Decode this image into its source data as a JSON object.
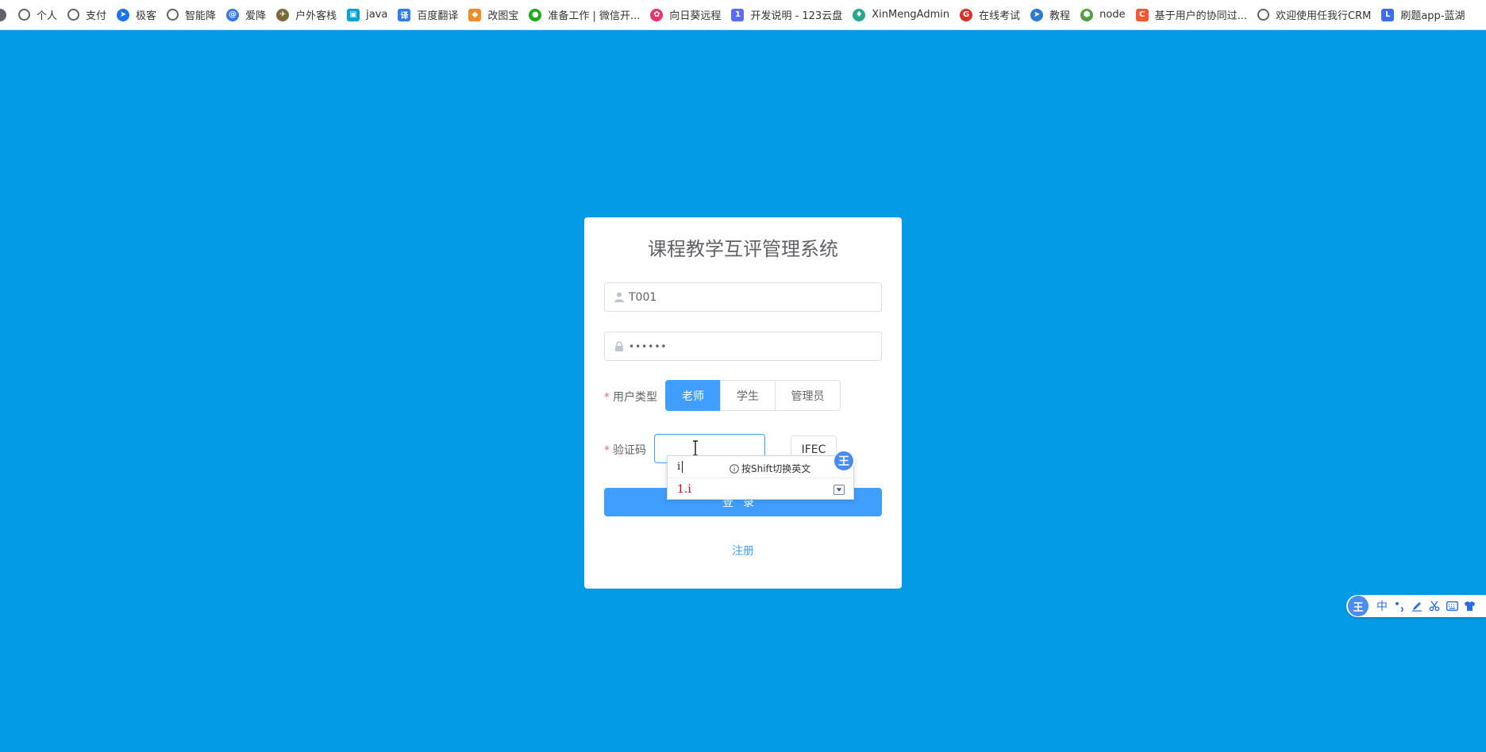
{
  "bookmarks": [
    {
      "label": "个人",
      "icon": "globe-icon",
      "color": "#5f6368"
    },
    {
      "label": "支付",
      "icon": "globe-icon",
      "color": "#5f6368"
    },
    {
      "label": "极客",
      "icon": "paper-plane-icon",
      "color": "#1a73e8"
    },
    {
      "label": "智能降",
      "icon": "globe-icon",
      "color": "#5f6368"
    },
    {
      "label": "爱降",
      "icon": "swirl-icon",
      "color": "#3478f6"
    },
    {
      "label": "户外客栈",
      "icon": "rocket-icon",
      "color": "#7a6a3a"
    },
    {
      "label": "java",
      "icon": "bilibili-icon",
      "color": "#00a1d6"
    },
    {
      "label": "百度翻译",
      "icon": "translate-icon",
      "color": "#2f7cf6"
    },
    {
      "label": "改图宝",
      "icon": "palette-icon",
      "color": "#f28c28"
    },
    {
      "label": "准备工作 | 微信开...",
      "icon": "wechat-icon",
      "color": "#1aad19"
    },
    {
      "label": "向日葵远程",
      "icon": "sunflower-icon",
      "color": "#e8346e"
    },
    {
      "label": "开发说明 - 123云盘",
      "icon": "cloud-123-icon",
      "color": "#5b6cf6"
    },
    {
      "label": "XinMengAdmin",
      "icon": "leaf-icon",
      "color": "#27a88a"
    },
    {
      "label": "在线考试",
      "icon": "g-icon",
      "color": "#d93025"
    },
    {
      "label": "教程",
      "icon": "bird-icon",
      "color": "#2e7bcf"
    },
    {
      "label": "node",
      "icon": "nodejs-icon",
      "color": "#539e43"
    },
    {
      "label": "基于用户的协同过...",
      "icon": "c-icon",
      "color": "#fc5531"
    },
    {
      "label": "欢迎使用任我行CRM",
      "icon": "globe-icon",
      "color": "#5f6368"
    },
    {
      "label": "刷题app-蓝湖",
      "icon": "lanhu-icon",
      "color": "#3d6cf0"
    }
  ],
  "login": {
    "title": "课程教学互评管理系统",
    "username_value": "T001",
    "password_mask": "••••••",
    "user_type_label": "用户类型",
    "user_types": [
      "老师",
      "学生",
      "管理员"
    ],
    "selected_user_type": "老师",
    "captcha_label": "验证码",
    "captcha_image_text": "IFEC",
    "login_button": "登录",
    "register_link": "注册"
  },
  "ime_popup": {
    "typed": "i",
    "hint": "按Shift切换英文",
    "logo": "王",
    "candidate": "1.i"
  },
  "ime_toolbar": {
    "logo": "王",
    "mode": "中",
    "items": [
      "punctuation-icon",
      "pen-icon",
      "scissors-icon",
      "keyboard-icon",
      "skin-icon"
    ]
  },
  "colors": {
    "background": "#039be5",
    "primary": "#409eff",
    "required": "#f56c6c"
  }
}
